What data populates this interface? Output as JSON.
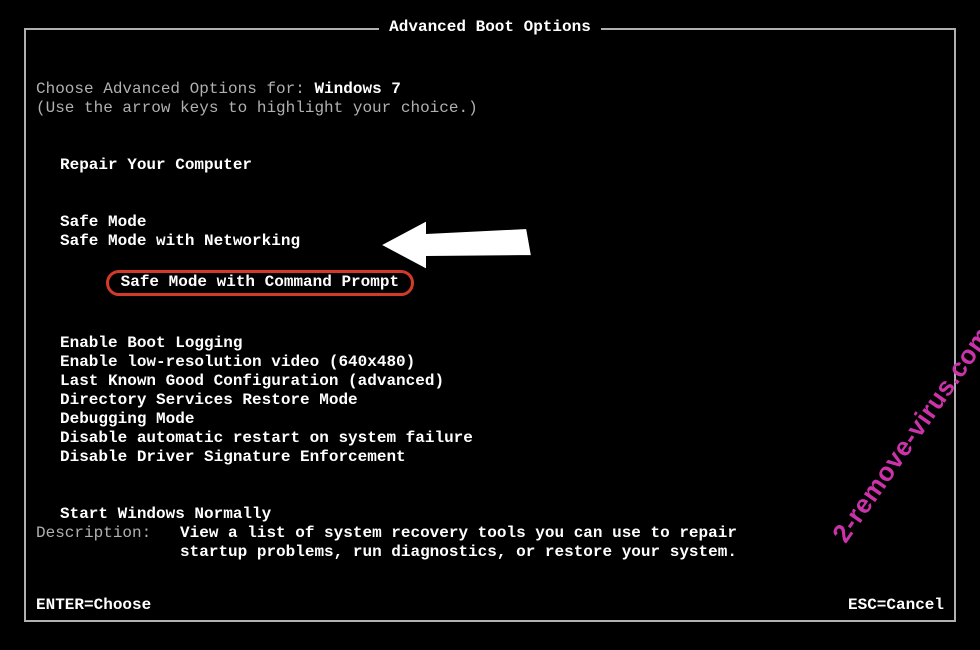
{
  "title": "Advanced Boot Options",
  "choose_prefix": "Choose Advanced Options for: ",
  "os_name": "Windows 7",
  "hint": "(Use the arrow keys to highlight your choice.)",
  "group1": [
    "Repair Your Computer"
  ],
  "group2": [
    "Safe Mode",
    "Safe Mode with Networking",
    "Safe Mode with Command Prompt"
  ],
  "group3": [
    "Enable Boot Logging",
    "Enable low-resolution video (640x480)",
    "Last Known Good Configuration (advanced)",
    "Directory Services Restore Mode",
    "Debugging Mode",
    "Disable automatic restart on system failure",
    "Disable Driver Signature Enforcement"
  ],
  "group4": [
    "Start Windows Normally"
  ],
  "description_label": "Description:",
  "description_text1": "View a list of system recovery tools you can use to repair",
  "description_text2": "startup problems, run diagnostics, or restore your system.",
  "footer_enter": "ENTER=Choose",
  "footer_esc": "ESC=Cancel",
  "watermark": "2-remove-virus.com",
  "highlight_index": 2
}
